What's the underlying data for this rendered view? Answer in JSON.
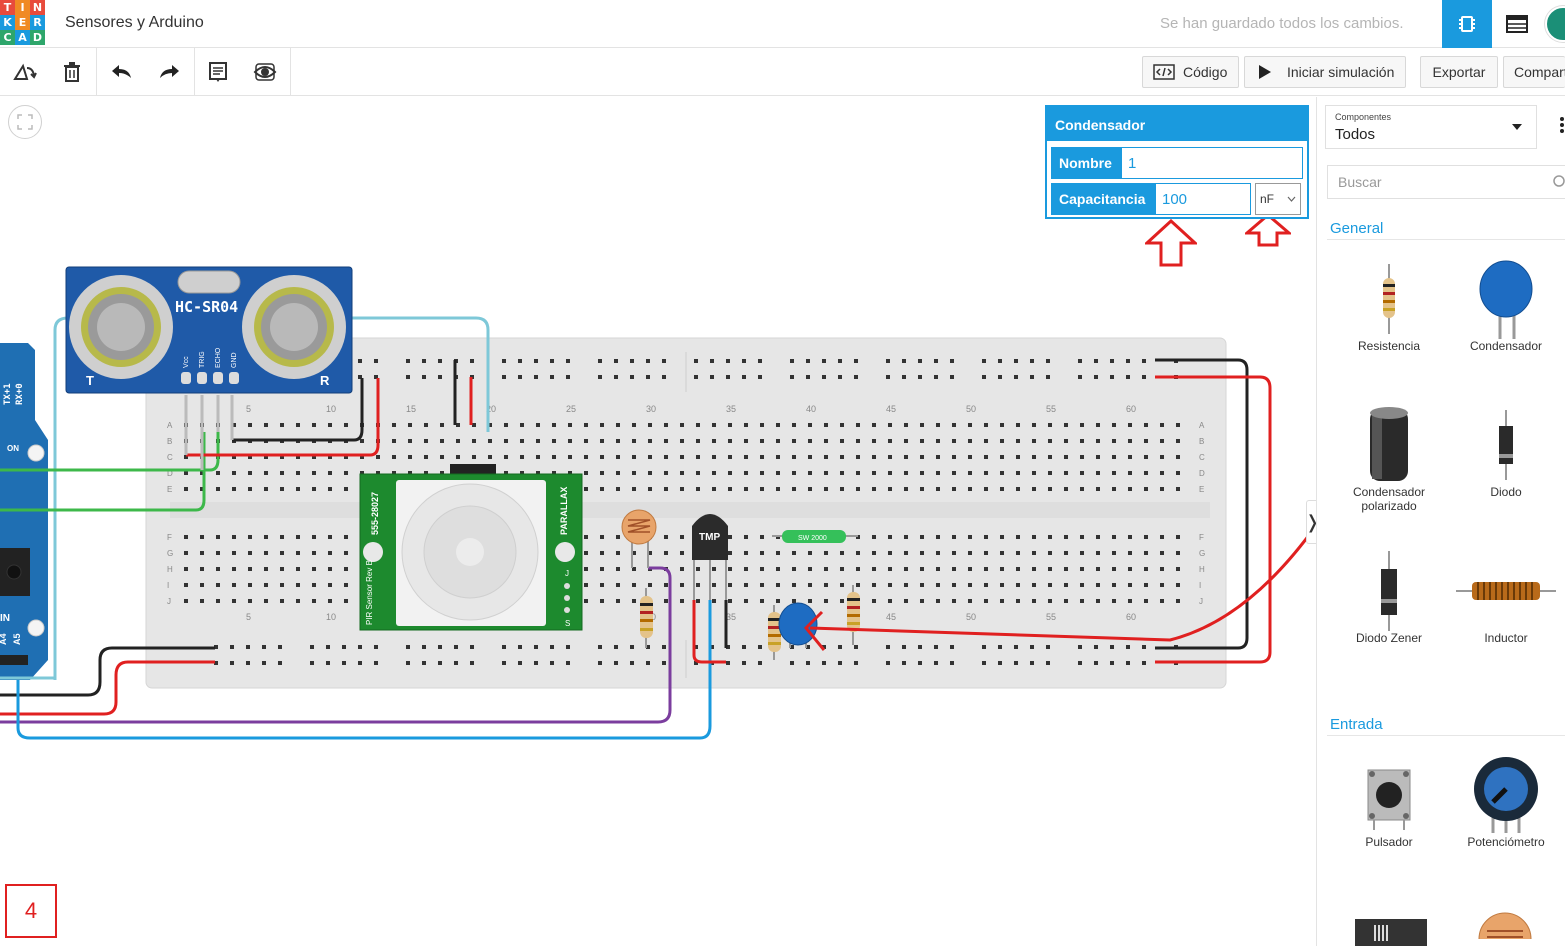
{
  "header": {
    "logo_letters": [
      "T",
      "I",
      "N",
      "K",
      "E",
      "R",
      "C",
      "A",
      "D"
    ],
    "logo_colors": [
      "#e84b3c",
      "#f08a24",
      "#e84b3c",
      "#1a9ade",
      "#f08a24",
      "#1a9ade",
      "#2ea66b",
      "#1a9ade",
      "#2ea66b"
    ],
    "project_title": "Sensores y Arduino",
    "save_status": "Se han guardado todos los cambios."
  },
  "toolbar": {
    "code_label": "Código",
    "start_sim_label": "Iniciar simulación",
    "export_label": "Exportar",
    "share_label": "Compartir"
  },
  "inspector": {
    "title": "Condensador",
    "name_label": "Nombre",
    "name_value": "1",
    "capacitance_label": "Capacitancia",
    "capacitance_value": "100",
    "unit_value": "nF"
  },
  "panel": {
    "components_small_label": "Componentes",
    "components_value": "Todos",
    "search_placeholder": "Buscar",
    "sections": [
      {
        "title": "General",
        "items": [
          "Resistencia",
          "Condensador",
          "Condensador polarizado",
          "Diodo",
          "Diodo Zener",
          "Inductor"
        ]
      },
      {
        "title": "Entrada",
        "items": [
          "Pulsador",
          "Potenciómetro"
        ]
      }
    ]
  },
  "canvas": {
    "sensor_label": "HC-SR04",
    "sensor_pins": [
      "Vcc",
      "TRIG",
      "ECHO",
      "GND"
    ],
    "pir_label_left": "555-28027",
    "pir_label_bottom": "PIR Sensor Rev B",
    "pir_label_right": "PARALLAX",
    "pir_pins": [
      "J",
      "S"
    ],
    "tmp_label": "TMP",
    "switch_label": "SW 2000",
    "breadboard_col_numbers": [
      "5",
      "10",
      "15",
      "20",
      "25",
      "30",
      "35",
      "40",
      "45",
      "50",
      "55",
      "60"
    ],
    "breadboard_row_letters_top": [
      "A",
      "B",
      "C",
      "D",
      "E"
    ],
    "breadboard_row_letters_bottom": [
      "F",
      "G",
      "H",
      "I",
      "J"
    ],
    "arduino_labels": [
      "TX+1",
      "RX+0",
      "ON",
      "IN",
      "A4",
      "A5"
    ],
    "step_number": "4"
  }
}
